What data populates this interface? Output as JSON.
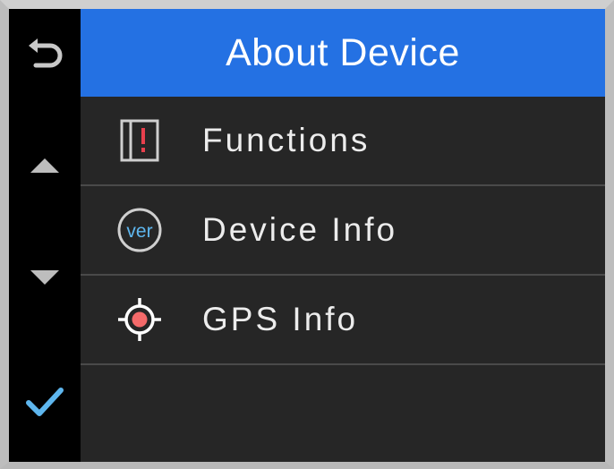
{
  "header": {
    "title": "About Device"
  },
  "sidebar": {
    "items": [
      {
        "name": "back",
        "icon": "back-arrow-icon"
      },
      {
        "name": "up",
        "icon": "triangle-up-icon"
      },
      {
        "name": "down",
        "icon": "triangle-down-icon"
      },
      {
        "name": "confirm",
        "icon": "checkmark-icon"
      }
    ]
  },
  "menu": {
    "items": [
      {
        "label": "Functions",
        "icon": "alert-panel-icon"
      },
      {
        "label": "Device Info",
        "icon": "version-icon",
        "icon_text": "ver"
      },
      {
        "label": "GPS Info",
        "icon": "gps-target-icon"
      }
    ]
  },
  "colors": {
    "header": "#2471e3",
    "sidebar": "#000000",
    "background": "#262626",
    "accent": "#5eb6ee",
    "alert": "#e8404d"
  }
}
